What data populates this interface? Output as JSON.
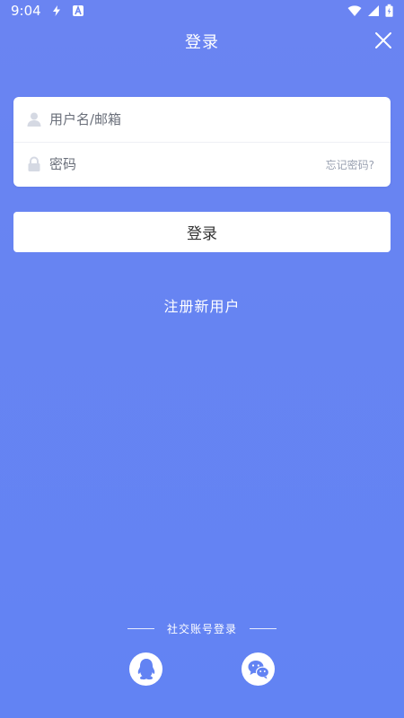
{
  "status_bar": {
    "time": "9:04"
  },
  "header": {
    "title": "登录"
  },
  "form": {
    "username_placeholder": "用户名/邮箱",
    "password_placeholder": "密码",
    "forgot_label": "忘记密码?"
  },
  "buttons": {
    "login_label": "登录",
    "register_label": "注册新用户"
  },
  "social": {
    "title": "社交账号登录",
    "providers": [
      "qq-icon",
      "wechat-icon"
    ]
  },
  "colors": {
    "background": "#6283f3",
    "card": "#ffffff",
    "accent": "#6283f3",
    "muted": "#9aa1b1"
  }
}
